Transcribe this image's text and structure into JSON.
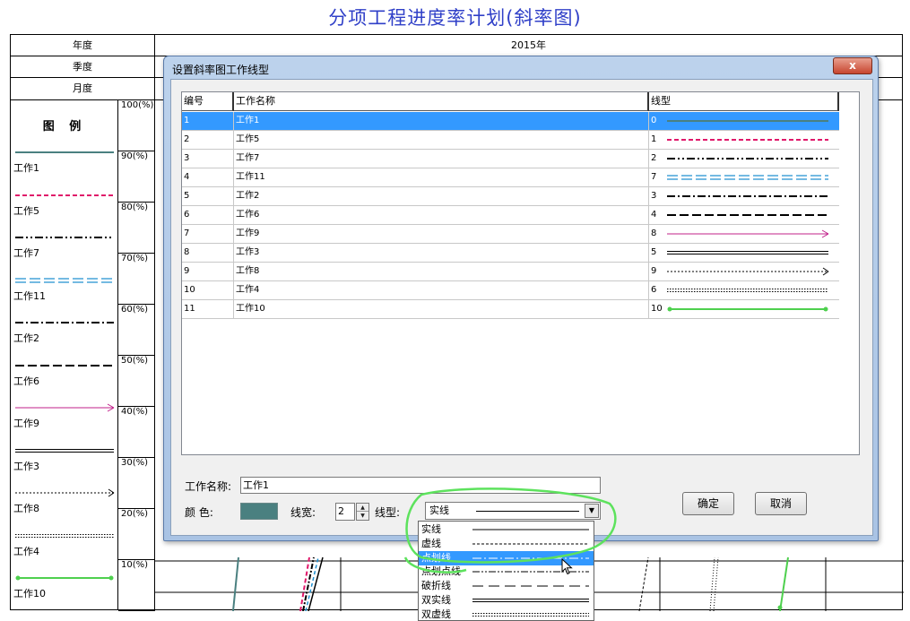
{
  "page": {
    "title": "分项工程进度率计划(斜率图)"
  },
  "sheet": {
    "year_label": "年度",
    "year_value": "2015年",
    "quarter_label": "季度",
    "month_label": "月度",
    "legend_title": "图 例",
    "percent_labels": [
      "100(%)",
      "90(%)",
      "80(%)",
      "70(%)",
      "60(%)",
      "50(%)",
      "40(%)",
      "30(%)",
      "20(%)",
      "10(%)"
    ],
    "legend_items": [
      {
        "label": "工作1",
        "style": "solid-teal"
      },
      {
        "label": "工作5",
        "style": "dashed-magenta"
      },
      {
        "label": "工作7",
        "style": "dashdotdot"
      },
      {
        "label": "工作11",
        "style": "double-dashed-blue"
      },
      {
        "label": "工作2",
        "style": "dashdot"
      },
      {
        "label": "工作6",
        "style": "long-dash"
      },
      {
        "label": "工作9",
        "style": "arrow-magenta"
      },
      {
        "label": "工作3",
        "style": "double-solid"
      },
      {
        "label": "工作8",
        "style": "dotted-arrow"
      },
      {
        "label": "工作4",
        "style": "double-dotted"
      },
      {
        "label": "工作10",
        "style": "green-dots"
      }
    ]
  },
  "dialog": {
    "title": "设置斜率图工作线型",
    "close_label": "x",
    "columns": {
      "id": "编号",
      "name": "工作名称",
      "linetype": "线型"
    },
    "rows": [
      {
        "id": "1",
        "name": "工作1",
        "type": "0",
        "style": "solid-teal",
        "selected": true
      },
      {
        "id": "2",
        "name": "工作5",
        "type": "1",
        "style": "dashed-magenta"
      },
      {
        "id": "3",
        "name": "工作7",
        "type": "2",
        "style": "dashdotdot"
      },
      {
        "id": "4",
        "name": "工作11",
        "type": "7",
        "style": "double-dashed-blue"
      },
      {
        "id": "5",
        "name": "工作2",
        "type": "3",
        "style": "dashdot"
      },
      {
        "id": "6",
        "name": "工作6",
        "type": "4",
        "style": "long-dash"
      },
      {
        "id": "7",
        "name": "工作9",
        "type": "8",
        "style": "arrow-magenta"
      },
      {
        "id": "8",
        "name": "工作3",
        "type": "5",
        "style": "double-solid"
      },
      {
        "id": "9",
        "name": "工作8",
        "type": "9",
        "style": "dotted-arrow"
      },
      {
        "id": "10",
        "name": "工作4",
        "type": "6",
        "style": "double-dotted"
      },
      {
        "id": "11",
        "name": "工作10",
        "type": "10",
        "style": "green-dots"
      }
    ],
    "form": {
      "name_label": "工作名称:",
      "name_value": "工作1",
      "color_label": "颜  色:",
      "color_value": "#4a8080",
      "width_label": "线宽:",
      "width_value": "2",
      "linetype_label": "线型:",
      "linetype_value": "实线"
    },
    "ok_label": "确定",
    "cancel_label": "取消"
  },
  "dropdown": {
    "options": [
      {
        "label": "实线",
        "style": "solid"
      },
      {
        "label": "虚线",
        "style": "dash"
      },
      {
        "label": "点划线",
        "style": "dashdot",
        "highlighted": true
      },
      {
        "label": "点划点线",
        "style": "dashdotdot"
      },
      {
        "label": "破折线",
        "style": "long-dash"
      },
      {
        "label": "双实线",
        "style": "double-solid"
      },
      {
        "label": "双虚线",
        "style": "double-dotted"
      }
    ]
  },
  "colors": {
    "accent": "#3399ff",
    "title": "#3040c8",
    "highlight_ring": "#5de25d"
  }
}
